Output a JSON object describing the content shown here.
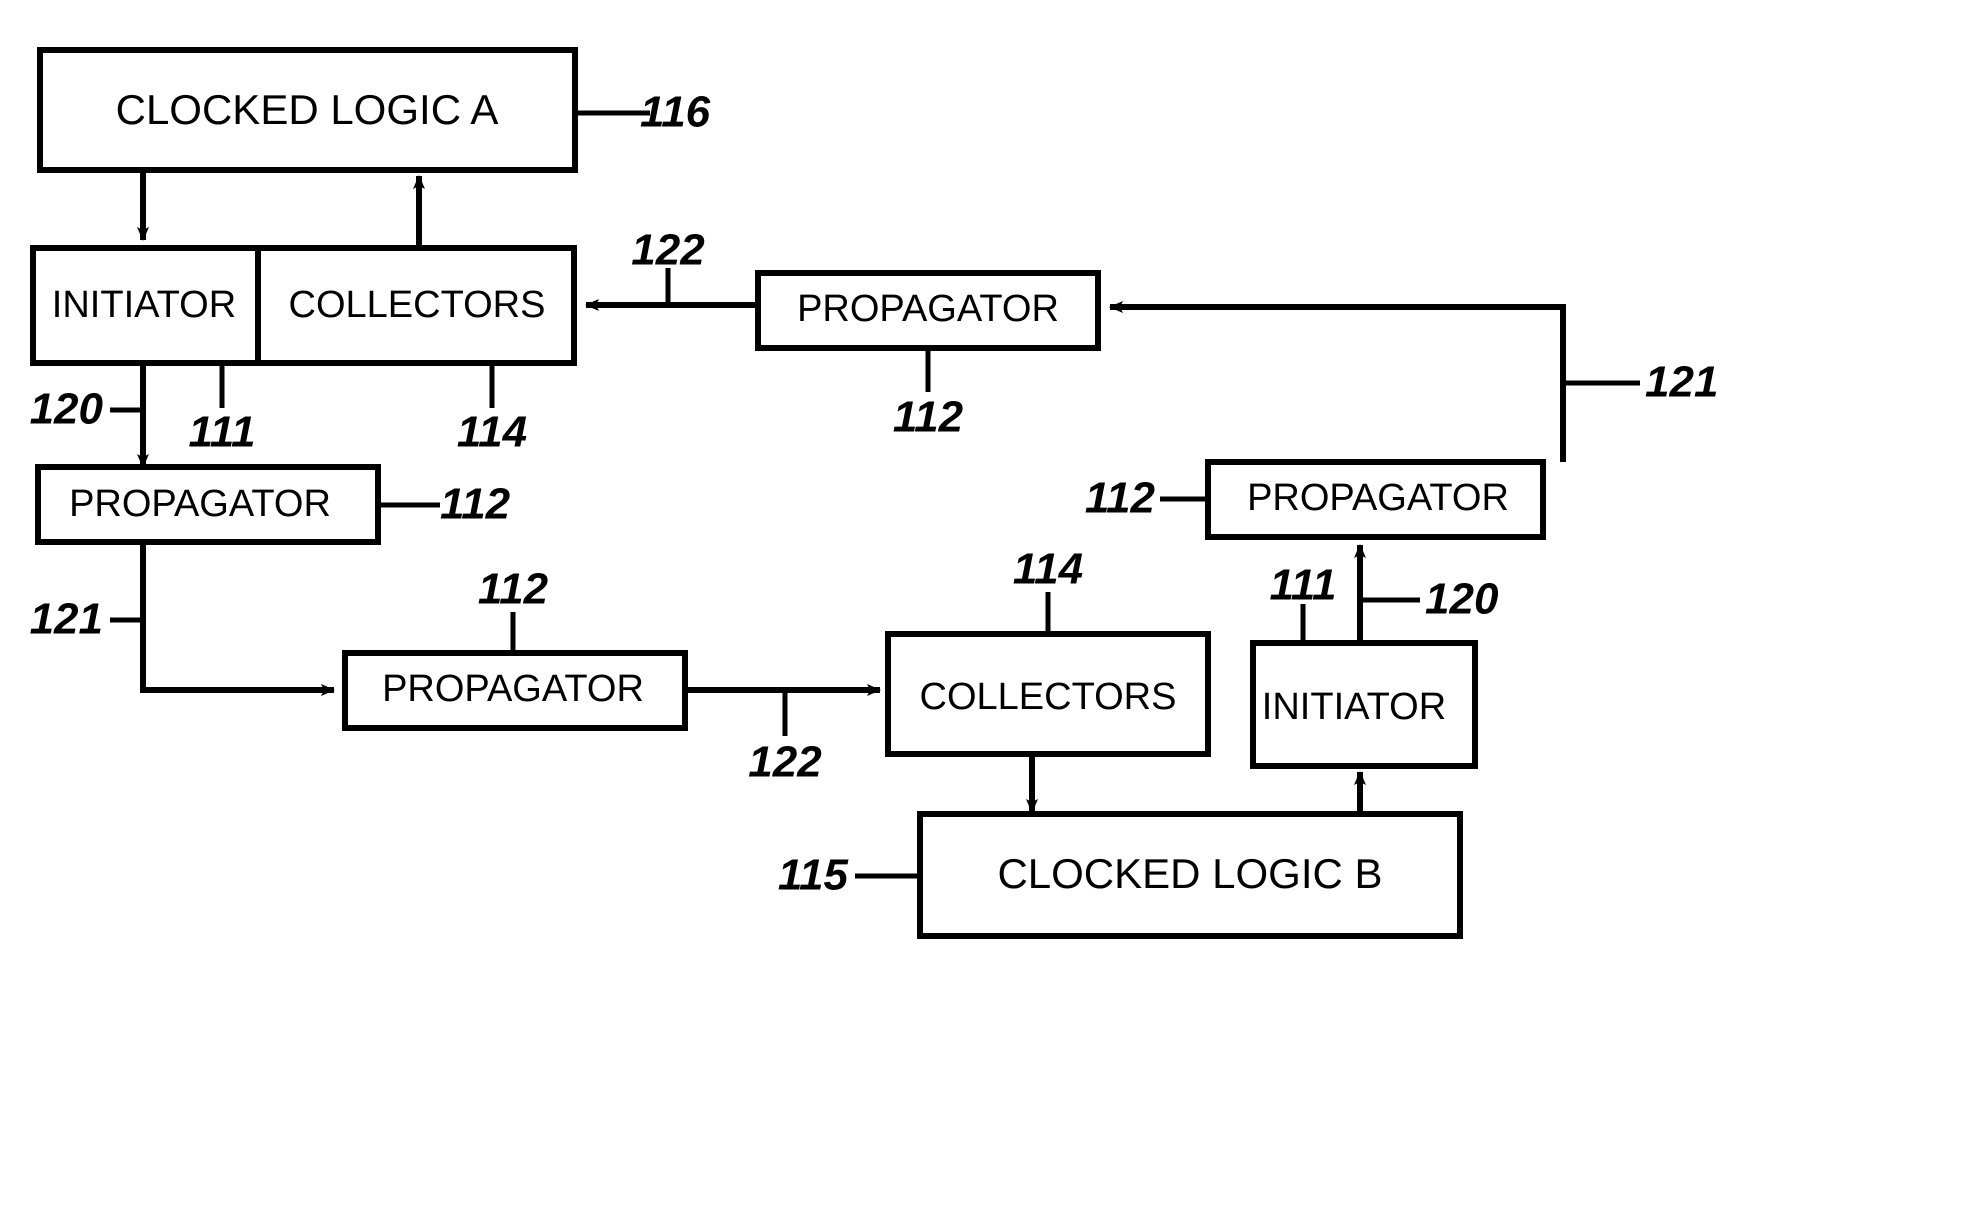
{
  "figure": {
    "title": "Clocked logic domain crossing block diagram",
    "background_color": "#ffffff",
    "line_color": "#000000"
  },
  "blocks": {
    "clocked_logic_a": {
      "label": "CLOCKED LOGIC A"
    },
    "initiator_a": {
      "label": "INITIATOR"
    },
    "collectors_a": {
      "label": "COLLECTORS"
    },
    "propagator_left": {
      "label": "PROPAGATOR"
    },
    "propagator_top_right": {
      "label": "PROPAGATOR"
    },
    "propagator_middle": {
      "label": "PROPAGATOR"
    },
    "propagator_right": {
      "label": "PROPAGATOR"
    },
    "collectors_b": {
      "label": "COLLECTORS"
    },
    "initiator_b": {
      "label": "INITIATOR"
    },
    "clocked_logic_b": {
      "label": "CLOCKED LOGIC B"
    }
  },
  "reference_numerals": {
    "logic_a": "116",
    "collectors_a_feed": "122",
    "initiator_a_out": "120",
    "initiator_a_tap": "111",
    "collectors_a_tap": "114",
    "propagator_left": "112",
    "propagator_top_right": "112",
    "propagator_left_out": "121",
    "propagator_middle": "112",
    "propagator_middle_out": "122",
    "collectors_b": "114",
    "propagator_right": "112",
    "propagator_right_in": "121",
    "initiator_b_out": "120",
    "initiator_b_tap": "111",
    "logic_b": "115"
  }
}
